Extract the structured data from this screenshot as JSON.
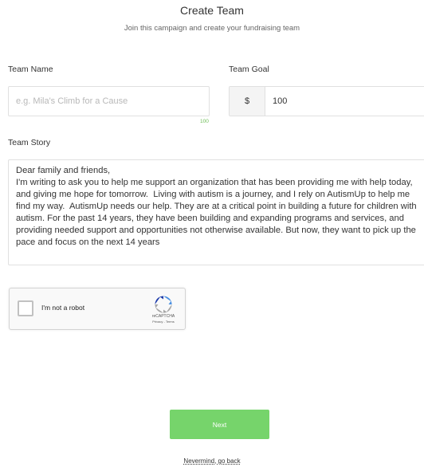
{
  "header": {
    "title": "Create Team",
    "subtitle": "Join this campaign and create your fundraising team"
  },
  "team_name": {
    "label": "Team Name",
    "placeholder": "e.g. Mila's Climb for a Cause",
    "value": "",
    "char_counter": "100"
  },
  "team_goal": {
    "label": "Team Goal",
    "currency_symbol": "$",
    "value": "100"
  },
  "team_story": {
    "label": "Team Story",
    "value": "Dear family and friends,\nI'm writing to ask you to help me support an organization that has been providing me with help today, and giving me hope for tomorrow.  Living with autism is a journey, and I rely on AutismUp to help me find my way.  AutismUp needs our help. They are at a critical point in building a future for children with autism. For the past 14 years, they have been building and expanding programs and services, and providing needed support and opportunities not otherwise available. But now, they want to pick up the pace and focus on the next 14 years"
  },
  "captcha": {
    "checkbox_label": "I'm not a robot",
    "checked": false,
    "brand": "reCAPTCHA",
    "links": "Privacy - Terms",
    "logo_icon": "recaptcha-logo-icon",
    "colors": {
      "blue": "#4a90e2",
      "dark_blue": "#1c3aa9",
      "gray": "#a6a6a6"
    }
  },
  "actions": {
    "next_label": "Next",
    "back_label": "Nevermind, go back"
  },
  "colors": {
    "accent_green": "#76d46b",
    "counter_green": "#6cbd55"
  }
}
